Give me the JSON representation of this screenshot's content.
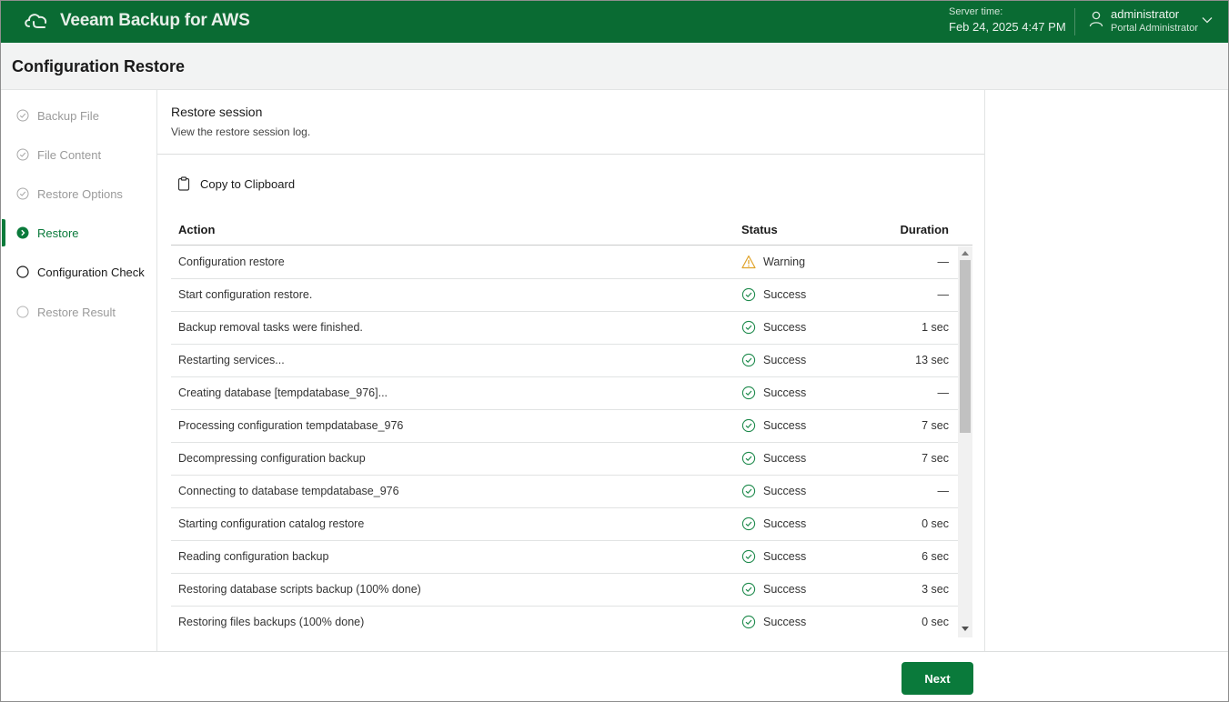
{
  "header": {
    "app_title": "Veeam Backup for AWS",
    "server_time_label": "Server time:",
    "server_time_value": "Feb 24, 2025 4:47 PM",
    "user_name": "administrator",
    "user_role": "Portal Administrator"
  },
  "page": {
    "title": "Configuration Restore"
  },
  "steps": [
    {
      "label": "Backup File",
      "state": "done"
    },
    {
      "label": "File Content",
      "state": "done"
    },
    {
      "label": "Restore Options",
      "state": "done"
    },
    {
      "label": "Restore",
      "state": "active"
    },
    {
      "label": "Configuration Check",
      "state": "current"
    },
    {
      "label": "Restore Result",
      "state": "pending"
    }
  ],
  "section": {
    "title": "Restore session",
    "subtitle": "View the restore session log."
  },
  "toolbar": {
    "copy_label": "Copy to Clipboard"
  },
  "table": {
    "columns": {
      "action": "Action",
      "status": "Status",
      "duration": "Duration"
    },
    "rows": [
      {
        "action": "Configuration restore",
        "status": "Warning",
        "duration": "—"
      },
      {
        "action": "Start configuration restore.",
        "status": "Success",
        "duration": "—"
      },
      {
        "action": "Backup removal tasks were finished.",
        "status": "Success",
        "duration": "1 sec"
      },
      {
        "action": "Restarting services...",
        "status": "Success",
        "duration": "13 sec"
      },
      {
        "action": "Creating database [tempdatabase_976]...",
        "status": "Success",
        "duration": "—"
      },
      {
        "action": "Processing configuration tempdatabase_976",
        "status": "Success",
        "duration": "7 sec"
      },
      {
        "action": "Decompressing configuration backup",
        "status": "Success",
        "duration": "7 sec"
      },
      {
        "action": "Connecting to database tempdatabase_976",
        "status": "Success",
        "duration": "—"
      },
      {
        "action": "Starting configuration catalog restore",
        "status": "Success",
        "duration": "0 sec"
      },
      {
        "action": "Reading configuration backup",
        "status": "Success",
        "duration": "6 sec"
      },
      {
        "action": "Restoring database scripts backup (100% done)",
        "status": "Success",
        "duration": "3 sec"
      },
      {
        "action": "Restoring files backups (100% done)",
        "status": "Success",
        "duration": "0 sec"
      }
    ]
  },
  "footer": {
    "next_label": "Next"
  },
  "colors": {
    "brand": "#0a6b33",
    "accent": "#0a7a3b",
    "success": "#1e8a4c",
    "warning": "#e0a32a"
  },
  "icons": {
    "logo": "veeam-cloud-icon",
    "user": "user-icon",
    "copy": "clipboard-icon",
    "success": "check-circle-icon",
    "warning": "warning-triangle-icon"
  }
}
